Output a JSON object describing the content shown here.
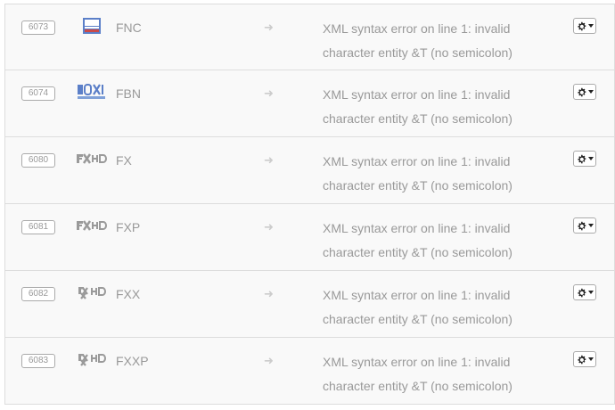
{
  "channels": [
    {
      "id": "6073",
      "logo": "fox-news-logo",
      "name": "FNC",
      "message": "XML syntax error on line 1: invalid character entity &T (no semicolon)"
    },
    {
      "id": "6074",
      "logo": "fox-business-logo",
      "name": "FBN",
      "message": "XML syntax error on line 1: invalid character entity &T (no semicolon)"
    },
    {
      "id": "6080",
      "logo": "fx-hd-logo",
      "name": "FX",
      "message": "XML syntax error on line 1: invalid character entity &T (no semicolon)"
    },
    {
      "id": "6081",
      "logo": "fx-hd-logo",
      "name": "FXP",
      "message": "XML syntax error on line 1: invalid character entity &T (no semicolon)"
    },
    {
      "id": "6082",
      "logo": "fxx-hd-logo",
      "name": "FXX",
      "message": "XML syntax error on line 1: invalid character entity &T (no semicolon)"
    },
    {
      "id": "6083",
      "logo": "fxx-hd-logo",
      "name": "FXXP",
      "message": "XML syntax error on line 1: invalid character entity &T (no semicolon)"
    }
  ],
  "icons": {
    "arrow": "right-arrow-icon",
    "settings": "gear-icon",
    "dropdown": "caret-down-icon"
  },
  "colors": {
    "row_background": "#f9f9f9",
    "border": "#dddddd",
    "muted_text": "#999999",
    "logo_gray": "#9a9a9a",
    "fox_blue": "#5b7fc8"
  }
}
